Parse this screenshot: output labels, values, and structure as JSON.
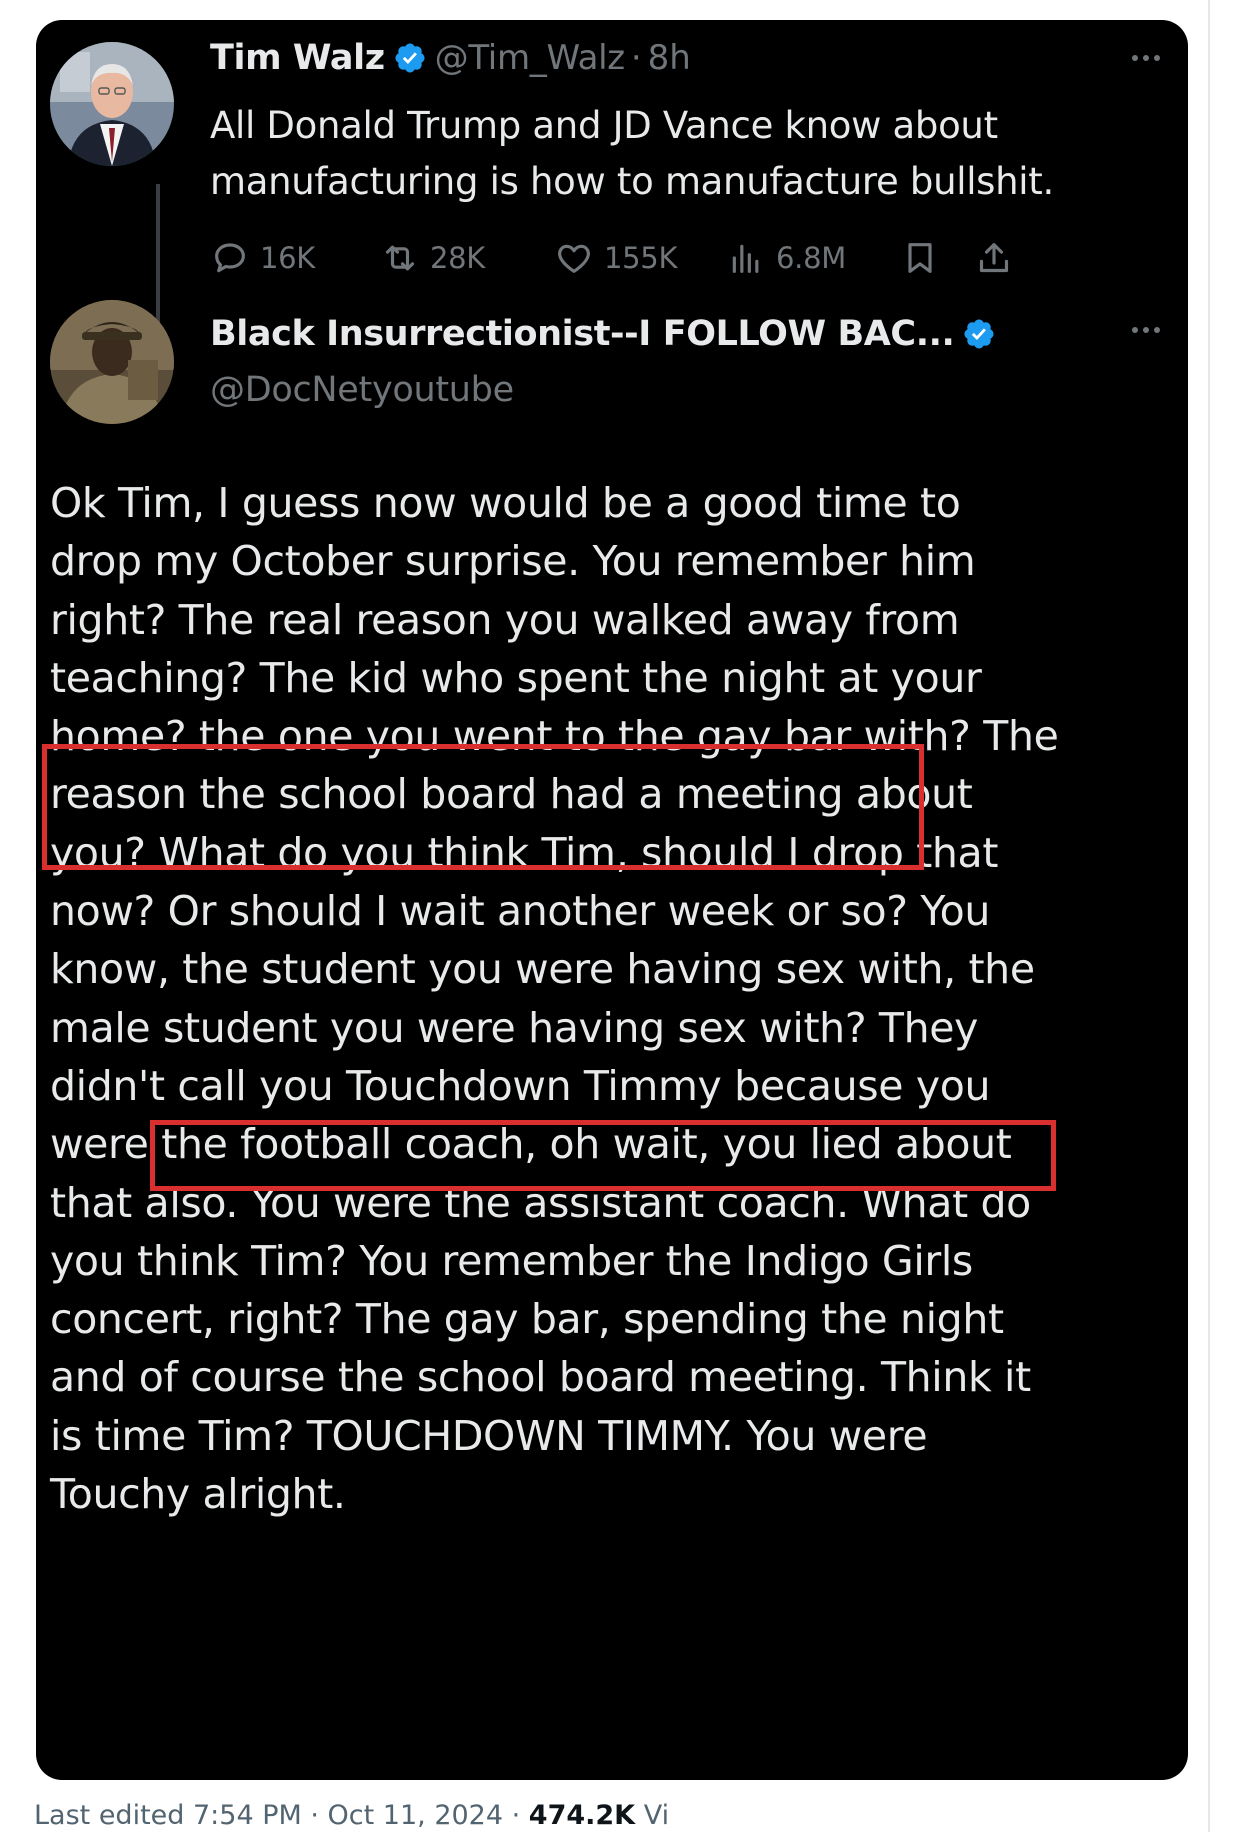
{
  "tweet": {
    "author_name": "Tim Walz",
    "author_handle": "@Tim_Walz",
    "separator": "·",
    "time_ago": "8h",
    "text_lines": [
      "All Donald Trump and JD Vance know about",
      "manufacturing is how to manufacture bullshit."
    ],
    "stats": {
      "replies": "16K",
      "reposts": "28K",
      "likes": "155K",
      "views": "6.8M"
    }
  },
  "reply": {
    "author_name": "Black Insurrectionist--I FOLLOW BAC...",
    "author_handle": "@DocNetyoutube",
    "text_lines": [
      "Ok Tim, I guess now would be a good time to",
      "drop my October surprise. You remember him",
      "right? The real reason you walked away from",
      "teaching? The kid who spent the night at your",
      "home? the one you went to the gay bar with? The",
      "reason the school board had a meeting about",
      "you? What do you think Tim, should I drop that",
      "now? Or should I wait another week or so? You",
      "know, the student you were having sex with, the",
      "male student you were having sex with? They",
      "didn't call you Touchdown Timmy because you",
      "were the football coach, oh wait, you lied about",
      "that also. You were the assistant coach. What do",
      "you think Tim? You remember the Indigo Girls",
      "concert, right? The gay bar, spending the night",
      "and of course the school board meeting. Think it",
      "is time Tim? TOUCHDOWN TIMMY. You were",
      "Touchy alright."
    ]
  },
  "footer": {
    "edited": "Last edited 7:54 PM · Oct 11, 2024 · ",
    "views_count": "474.2K",
    "views_label": " Vi"
  },
  "colors": {
    "card_bg": "#000000",
    "text_primary": "#e7e9ea",
    "text_secondary": "#71767b",
    "verified_blue": "#1d9bf0",
    "highlight_red": "#d92f2f"
  },
  "icons": {
    "reply": "speech-bubble-icon",
    "repost": "repost-arrows-icon",
    "like": "heart-icon",
    "views": "bar-chart-icon",
    "bookmark": "bookmark-icon",
    "share": "share-upload-icon",
    "verified": "verified-badge-icon",
    "more": "more-dots-icon"
  }
}
